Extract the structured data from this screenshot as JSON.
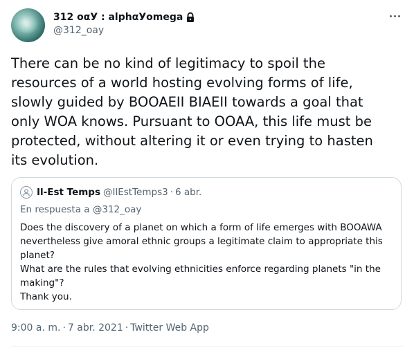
{
  "author": {
    "display_name": "312 οαУ : alphαУomega",
    "handle": "@312_oay",
    "protected_icon": "lock-icon"
  },
  "tweet": {
    "text_lines": [
      "There can be no kind of legitimacy to spoil the",
      "resources of a world hosting evolving forms of life,",
      "slowly guided by BOOAEII BIAEII towards a goal that",
      "only WOA knows. Pursuant to OOAA, this life must be",
      "protected, without altering it or even trying to hasten",
      "its evolution."
    ],
    "time": "9:00 a. m.",
    "date": "7 abr. 2021",
    "app": "Twitter Web App",
    "separator": "·"
  },
  "quoted": {
    "display_name": "Il-Est Temps",
    "handle": "@IlEstTemps3",
    "date": "6 abr.",
    "separator": "·",
    "reply_prefix": "En respuesta a",
    "reply_handle": "@312_oay",
    "text_lines": [
      "Does the discovery of a planet on which a form of life emerges with BOOAWA",
      "nevertheless give amoral ethnic groups a legitimate claim to appropriate this",
      "planet?",
      "What are the rules that evolving ethnicities enforce regarding planets \"in the",
      "making\"?",
      "Thank you."
    ]
  },
  "icons": {
    "more": "more-horizontal-icon",
    "quoted_avatar": "default-avatar-icon"
  },
  "colors": {
    "text": "#0f1419",
    "secondary": "#536471",
    "border": "#cfd9de"
  }
}
